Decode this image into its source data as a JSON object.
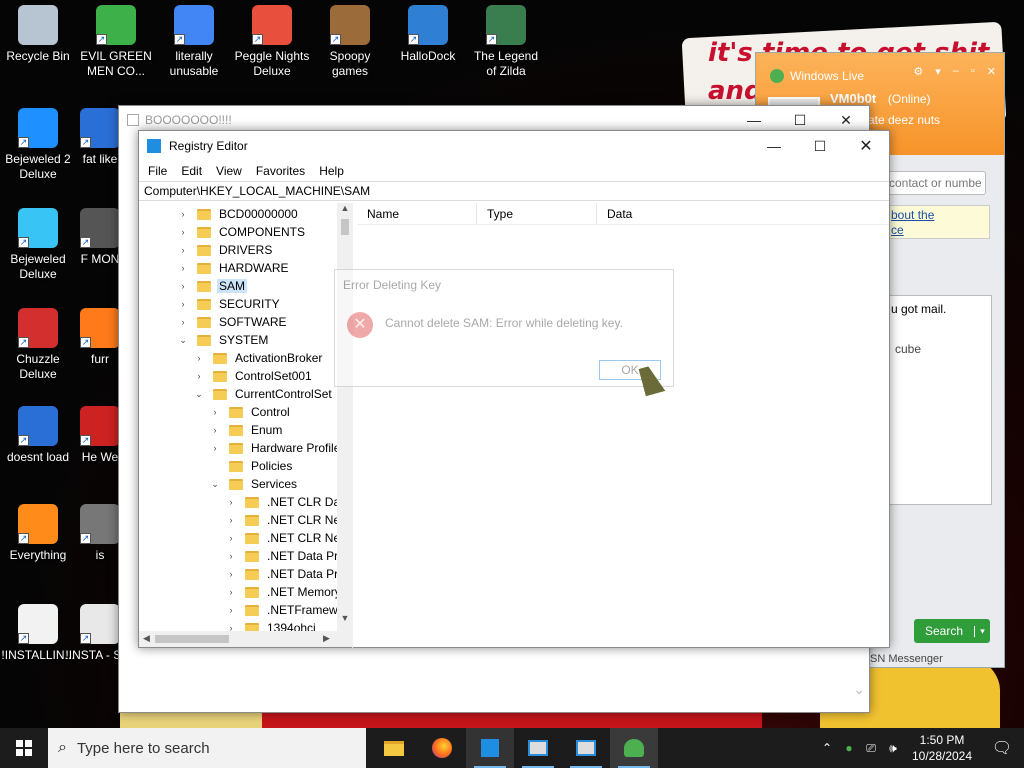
{
  "wallpaper": {
    "note_text": "it's time to get shit and"
  },
  "desktop_icons": [
    {
      "label": "Recycle Bin",
      "name": "recycle-bin"
    },
    {
      "label": "EVIL GREEN MEN CO...",
      "name": "evil-green-men"
    },
    {
      "label": "literally unusable",
      "name": "chrome"
    },
    {
      "label": "Peggle Nights Deluxe",
      "name": "peggle"
    },
    {
      "label": "Spoopy games",
      "name": "spoopy-games"
    },
    {
      "label": "HalloDock",
      "name": "hallodock"
    },
    {
      "label": "The Legend of Zilda",
      "name": "legend-of-zilda"
    },
    {
      "label": "Bejeweled 2 Deluxe",
      "name": "bejeweled-2"
    },
    {
      "label": "fat like",
      "name": "fat-like"
    },
    {
      "label": "Bejeweled Deluxe",
      "name": "bejeweled"
    },
    {
      "label": "F MON",
      "name": "f-mon"
    },
    {
      "label": "Chuzzle Deluxe",
      "name": "chuzzle"
    },
    {
      "label": "furr",
      "name": "furr"
    },
    {
      "label": "doesnt load",
      "name": "thunderbird"
    },
    {
      "label": "He We",
      "name": "he-we"
    },
    {
      "label": "Everything",
      "name": "everything"
    },
    {
      "label": "is",
      "name": "is"
    },
    {
      "label": "!INSTALLIN...",
      "name": "installing"
    },
    {
      "label": "!INSTA - Sho",
      "name": "installing-shortcut"
    }
  ],
  "back_window": {
    "title": "BOOOOOOO!!!!"
  },
  "registry_editor": {
    "title": "Registry Editor",
    "menu": [
      "File",
      "Edit",
      "View",
      "Favorites",
      "Help"
    ],
    "address": "Computer\\HKEY_LOCAL_MACHINE\\SAM",
    "tree": [
      {
        "label": "BCD00000000",
        "level": 1,
        "chev": "›",
        "selected": false
      },
      {
        "label": "COMPONENTS",
        "level": 1,
        "chev": "›",
        "selected": false
      },
      {
        "label": "DRIVERS",
        "level": 1,
        "chev": "›",
        "selected": false
      },
      {
        "label": "HARDWARE",
        "level": 1,
        "chev": "›",
        "selected": false
      },
      {
        "label": "SAM",
        "level": 1,
        "chev": "›",
        "selected": true
      },
      {
        "label": "SECURITY",
        "level": 1,
        "chev": "›",
        "selected": false
      },
      {
        "label": "SOFTWARE",
        "level": 1,
        "chev": "›",
        "selected": false
      },
      {
        "label": "SYSTEM",
        "level": 1,
        "chev": "⌄",
        "selected": false
      },
      {
        "label": "ActivationBroker",
        "level": 2,
        "chev": "›",
        "selected": false
      },
      {
        "label": "ControlSet001",
        "level": 2,
        "chev": "›",
        "selected": false
      },
      {
        "label": "CurrentControlSet",
        "level": 2,
        "chev": "⌄",
        "selected": false
      },
      {
        "label": "Control",
        "level": 3,
        "chev": "›",
        "selected": false
      },
      {
        "label": "Enum",
        "level": 3,
        "chev": "›",
        "selected": false
      },
      {
        "label": "Hardware Profiles",
        "level": 3,
        "chev": "›",
        "selected": false
      },
      {
        "label": "Policies",
        "level": 3,
        "chev": "",
        "selected": false
      },
      {
        "label": "Services",
        "level": 3,
        "chev": "⌄",
        "selected": false
      },
      {
        "label": ".NET CLR Data",
        "level": 4,
        "chev": "›",
        "selected": false
      },
      {
        "label": ".NET CLR Netw",
        "level": 4,
        "chev": "›",
        "selected": false
      },
      {
        "label": ".NET CLR Netw",
        "level": 4,
        "chev": "›",
        "selected": false
      },
      {
        "label": ".NET Data Prov",
        "level": 4,
        "chev": "›",
        "selected": false
      },
      {
        "label": ".NET Data Prov",
        "level": 4,
        "chev": "›",
        "selected": false
      },
      {
        "label": ".NET Memory",
        "level": 4,
        "chev": "›",
        "selected": false
      },
      {
        "label": ".NETFramewor",
        "level": 4,
        "chev": "›",
        "selected": false
      },
      {
        "label": "1394ohci",
        "level": 4,
        "chev": "›",
        "selected": false
      }
    ],
    "columns": [
      "Name",
      "Type",
      "Data"
    ]
  },
  "error_dialog": {
    "title": "Error Deleting Key",
    "message": "Cannot delete SAM: Error while deleting key.",
    "ok_label": "OK"
  },
  "msn": {
    "header_title": "Windows Live",
    "username": "VM0b0t",
    "status": "(Online)",
    "personal_message": "rate deez nuts",
    "search_placeholder": "contact or numbe",
    "link_text_1": "bout the",
    "link_text_2": "ce",
    "mail_text": "u got mail.",
    "cube_text": "cube",
    "search_button": "Search",
    "footer": "SN Messenger"
  },
  "taskbar": {
    "search_placeholder": "Type here to search",
    "time": "1:50 PM",
    "date": "10/28/2024"
  },
  "colors": {
    "taskbar_bg": "#1c1c1c",
    "selection": "#cce4f7",
    "folder": "#f5cd55",
    "msn_orange": "#f7932a",
    "msn_green": "#2e9d3a"
  }
}
